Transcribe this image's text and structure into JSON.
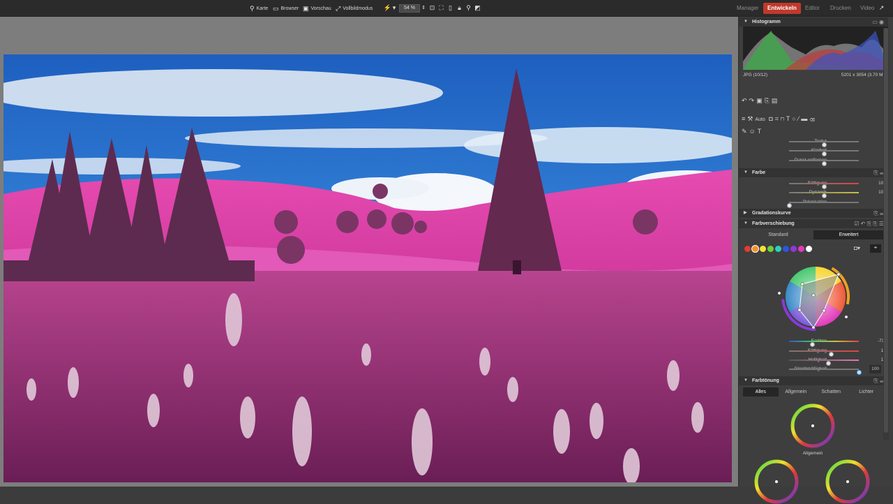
{
  "toolbar": {
    "items": [
      {
        "icon": "map-pin-icon",
        "label": "Karte"
      },
      {
        "icon": "folder-icon",
        "label": "Browser"
      },
      {
        "icon": "image-icon",
        "label": "Vorschau"
      },
      {
        "icon": "fullscreen-icon",
        "label": "Vollbildmodus"
      }
    ],
    "zoom": "54 %"
  },
  "modules": [
    "Manager",
    "Entwickeln",
    "Editor",
    "Drucken",
    "Video"
  ],
  "active_module": "Entwickeln",
  "histogram": {
    "title": "Histogramm",
    "format": "JPG (10/12)",
    "dimensions": "5201 x 3054 (3.70 MB)"
  },
  "tools": {
    "auto_label": "Auto"
  },
  "detail": {
    "sliders": [
      {
        "label": "Textur",
        "value": "0",
        "pos": 0.5
      },
      {
        "label": "Klarheit",
        "value": "0",
        "pos": 0.5
      },
      {
        "label": "Dunst entfernen",
        "value": "0",
        "pos": 0.5
      }
    ]
  },
  "farbe": {
    "title": "Farbe",
    "sliders": [
      {
        "label": "Sättigung",
        "value": "100",
        "pos": 0.5
      },
      {
        "label": "Dynamik",
        "value": "100",
        "pos": 0.5
      },
      {
        "label": "Polarisation",
        "value": "0",
        "pos": 0.0
      }
    ]
  },
  "gradation": {
    "title": "Gradationskurve"
  },
  "farbverschiebung": {
    "title": "Farbverschiebung",
    "tabs": [
      "Standard",
      "Erweitert"
    ],
    "active_tab": "Erweitert",
    "swatches": [
      "#e23b2e",
      "#f0902a",
      "#f3e03b",
      "#6bd13a",
      "#2ecfc0",
      "#2e55dd",
      "#8a3ad8",
      "#e03ab9",
      "#ffffff"
    ],
    "sliders": [
      {
        "label": "Farbton",
        "value": "-73°",
        "pos": 0.33
      },
      {
        "label": "Sättigung",
        "value": "19",
        "pos": 0.6
      },
      {
        "label": "Helligkeit",
        "value": "12",
        "pos": 0.56
      },
      {
        "label": "Gleichmäßigkeit",
        "value": "100",
        "pos": 1.0
      }
    ]
  },
  "farbtoenung": {
    "title": "Farbtönung",
    "tabs": [
      "Alles",
      "Allgemein",
      "Schatten",
      "Lichter"
    ],
    "active_tab": "Alles",
    "wheel_label": "Allgemein"
  },
  "colors": {
    "accent": "#c0392b",
    "panel": "#3e3e3e",
    "workspace": "#7d7d7d"
  }
}
